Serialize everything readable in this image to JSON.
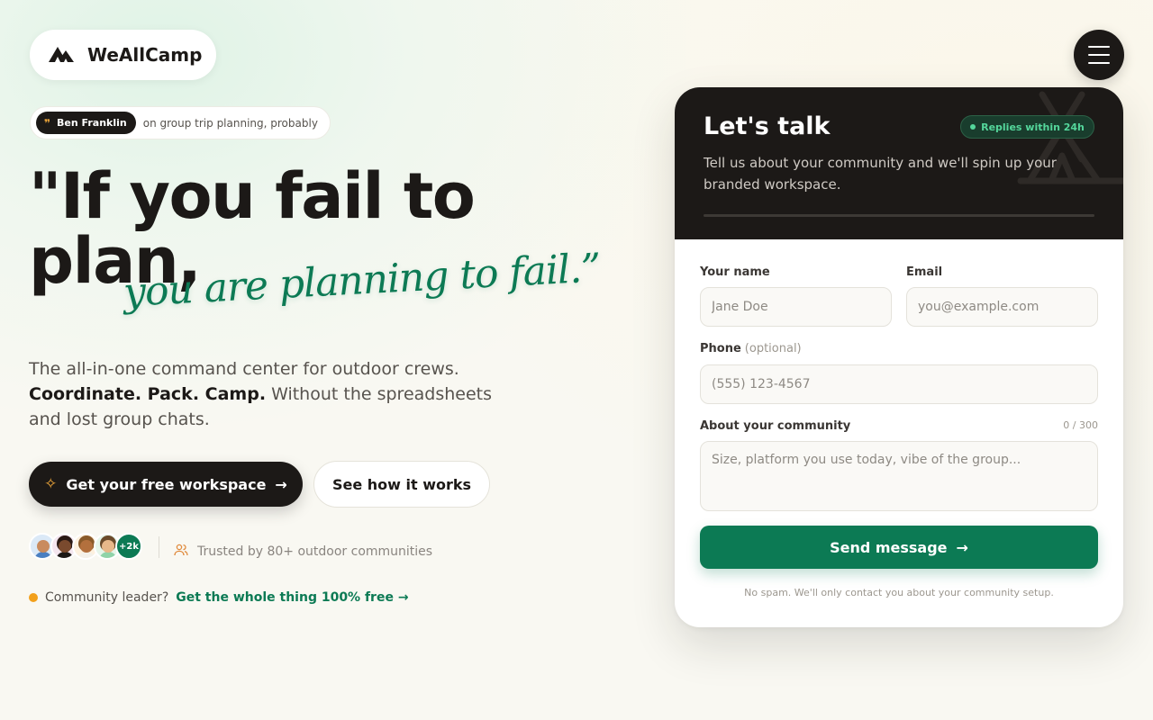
{
  "header": {
    "brand": "WeAllCamp",
    "logo_icon": "mountains-icon",
    "menu_icon": "hamburger-icon"
  },
  "hero": {
    "quote_author": "Ben Franklin",
    "quote_context": "on group trip planning, probably",
    "headline": "\"If you fail to plan,",
    "headline_script": "you are planning to fail.”",
    "lead_intro": "The all-in-one command center for outdoor crews.",
    "lead_bold": "Coordinate. Pack. Camp.",
    "lead_rest": "Without the spreadsheets and lost group chats.",
    "primary_cta": "Get your free workspace",
    "secondary_cta": "See how it works",
    "avatar_more": "+2k",
    "trusted_text": "Trusted by 80+ outdoor communities",
    "leader_question": "Community leader?",
    "leader_link": "Get the whole thing 100% free →"
  },
  "contact": {
    "title": "Let's talk",
    "badge": "Replies within 24h",
    "subtitle": "Tell us about your community and we'll spin up your branded workspace.",
    "name_label": "Your name",
    "name_placeholder": "Jane Doe",
    "email_label": "Email",
    "email_placeholder": "you@example.com",
    "phone_label": "Phone",
    "phone_optional": "(optional)",
    "phone_placeholder": "(555) 123-4567",
    "about_label": "About your community",
    "about_counter": "0 / 300",
    "about_placeholder": "Size, platform you use today, vibe of the group...",
    "submit": "Send message",
    "disclaimer": "No spam. We'll only contact you about your community setup."
  },
  "colors": {
    "brand_green": "#0c7a54",
    "ink": "#1c1917",
    "accent_amber": "#f2a93b"
  }
}
